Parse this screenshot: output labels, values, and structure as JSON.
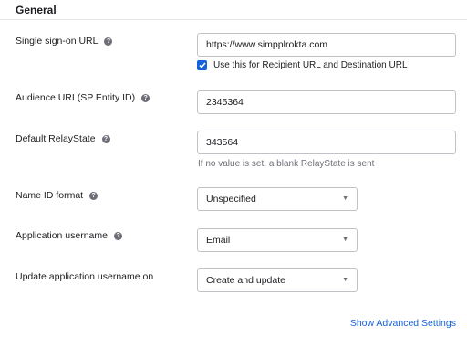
{
  "section": {
    "title": "General"
  },
  "fields": {
    "sso_url": {
      "label": "Single sign-on URL",
      "value": "https://www.simpplrokta.com",
      "checkbox_label": "Use this for Recipient URL and Destination URL",
      "checkbox_checked": true
    },
    "audience_uri": {
      "label": "Audience URI (SP Entity ID)",
      "value": "2345364"
    },
    "relay_state": {
      "label": "Default RelayState",
      "value": "343564",
      "hint": "If no value is set, a blank RelayState is sent"
    },
    "name_id_format": {
      "label": "Name ID format",
      "selected": "Unspecified"
    },
    "app_username": {
      "label": "Application username",
      "selected": "Email"
    },
    "update_username": {
      "label": "Update application username on",
      "selected": "Create and update"
    }
  },
  "help_icon_glyph": "?",
  "caret_glyph": "▼",
  "links": {
    "advanced": "Show Advanced Settings"
  },
  "colors": {
    "accent": "#1662dd",
    "help_icon": "#6e6e78",
    "border": "#c1c1c8"
  }
}
